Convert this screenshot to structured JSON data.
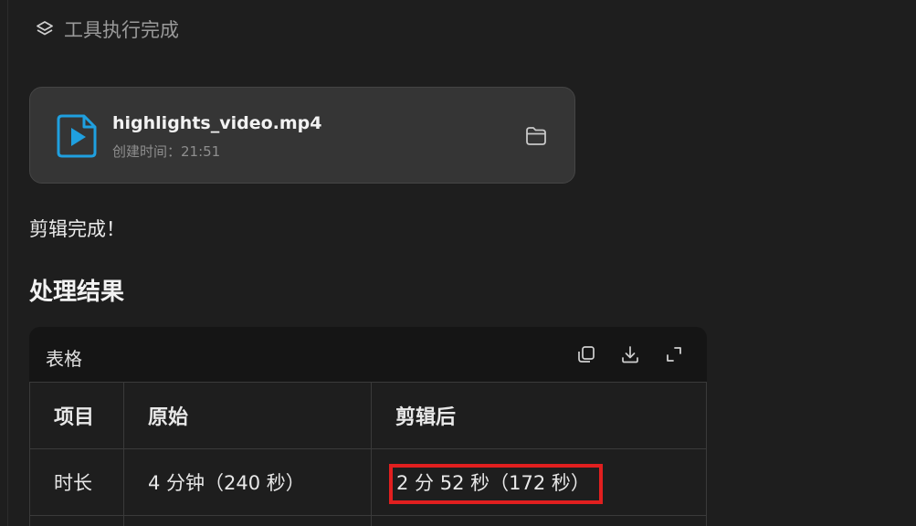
{
  "tool_status": {
    "icon": "layers-icon",
    "label": "工具执行完成"
  },
  "file_card": {
    "icon": "video-file-icon",
    "accent_color": "#1fa0e0",
    "name": "highlights_video.mp4",
    "meta": "创建时间：21:51",
    "folder_icon": "folder-icon"
  },
  "message": "剪辑完成！",
  "section_title": "处理结果",
  "table": {
    "header_label": "表格",
    "actions": [
      "copy-icon",
      "download-icon",
      "expand-icon"
    ],
    "columns": [
      "项目",
      "原始",
      "剪辑后"
    ],
    "rows": [
      [
        "时长",
        "4 分钟（240 秒）",
        "2 分 52 秒（172 秒）"
      ]
    ],
    "highlight_color": "#e11f1f"
  }
}
